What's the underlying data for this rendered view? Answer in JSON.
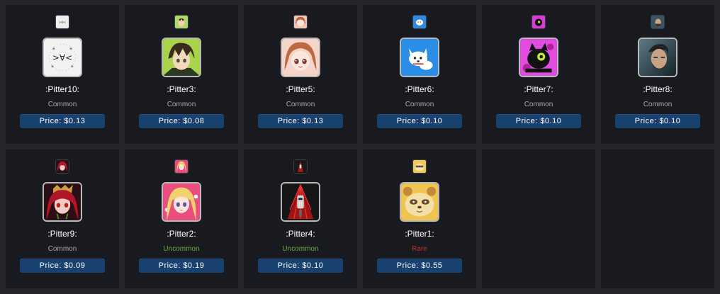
{
  "colors": {
    "common": "#a9aaae",
    "uncommon": "#6fae3a",
    "rare": "#b7382c",
    "price_button": "#19416f"
  },
  "items": [
    {
      "name": ":Pitter10:",
      "rarity": "Common",
      "price": "Price: $0.13",
      "rarity_color": "#a9aaae",
      "icon": "kaomoji-face-icon"
    },
    {
      "name": ":Pitter3:",
      "rarity": "Common",
      "price": "Price: $0.08",
      "rarity_color": "#a9aaae",
      "icon": "anime-boy-icon"
    },
    {
      "name": ":Pitter5:",
      "rarity": "Common",
      "price": "Price: $0.13",
      "rarity_color": "#a9aaae",
      "icon": "anime-girl-icon"
    },
    {
      "name": ":Pitter6:",
      "rarity": "Common",
      "price": "Price: $0.10",
      "rarity_color": "#a9aaae",
      "icon": "white-dog-icon"
    },
    {
      "name": ":Pitter7:",
      "rarity": "Common",
      "price": "Price: $0.10",
      "rarity_color": "#a9aaae",
      "icon": "black-cat-icon"
    },
    {
      "name": ":Pitter8:",
      "rarity": "Common",
      "price": "Price: $0.10",
      "rarity_color": "#a9aaae",
      "icon": "bearded-man-icon"
    },
    {
      "name": ":Pitter9:",
      "rarity": "Common",
      "price": "Price: $0.09",
      "rarity_color": "#a9aaae",
      "icon": "red-haired-girl-icon"
    },
    {
      "name": ":Pitter2:",
      "rarity": "Uncommon",
      "price": "Price: $0.19",
      "rarity_color": "#6fae3a",
      "icon": "blonde-girl-icon"
    },
    {
      "name": ":Pitter4:",
      "rarity": "Uncommon",
      "price": "Price: $0.10",
      "rarity_color": "#6fae3a",
      "icon": "dark-figure-icon"
    },
    {
      "name": ":Pitter1:",
      "rarity": "Rare",
      "price": "Price: $0.55",
      "rarity_color": "#b7382c",
      "icon": "raccoon-icon"
    }
  ]
}
